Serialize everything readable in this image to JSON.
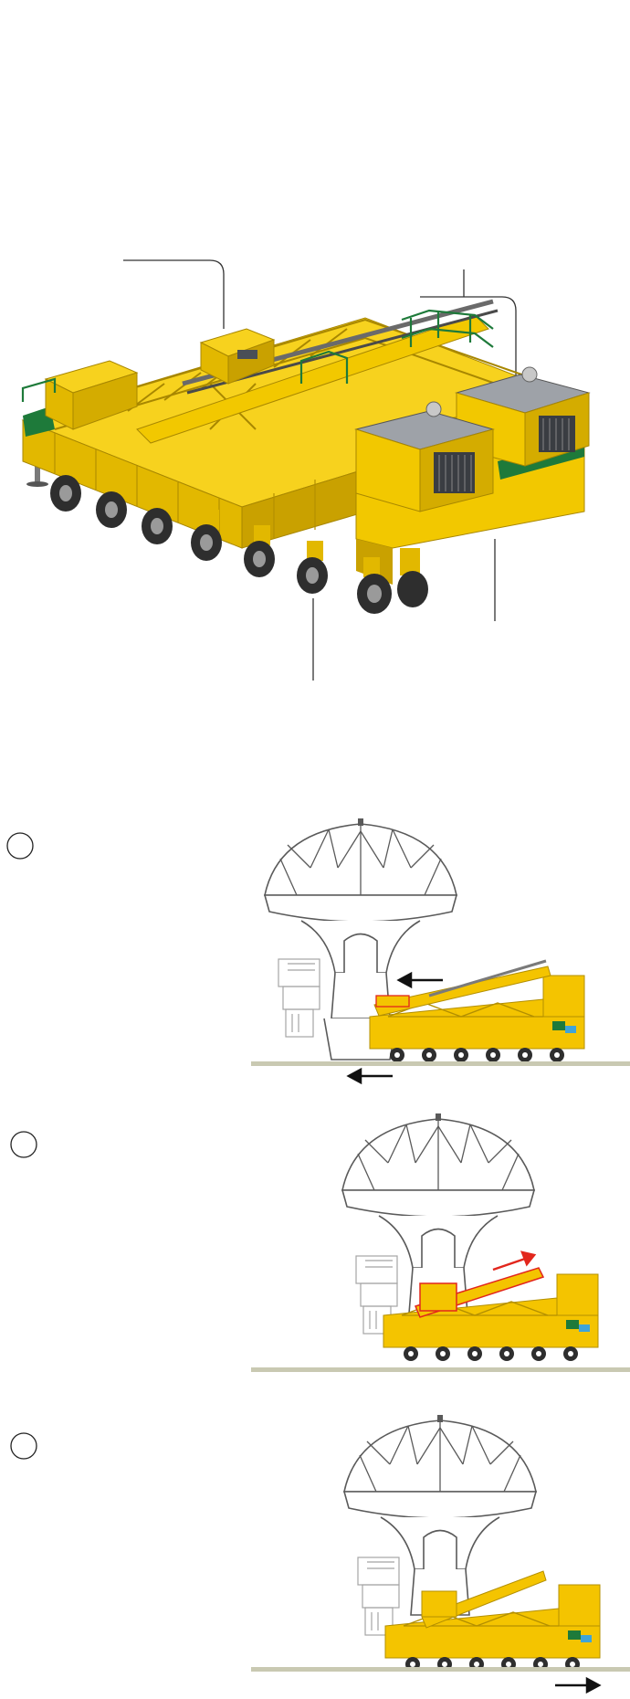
{
  "colors": {
    "vehicle_yellow": "#F4C400",
    "vehicle_dark": "#B89200",
    "vehicle_shadow": "#8C6E00",
    "rail_green": "#1E7A3A",
    "panel_grey": "#9EA2A8",
    "panel_dark": "#4A4F57",
    "tyre": "#2E2E2E",
    "ground": "#C9C9B2",
    "antenna_line": "#5A5A5A",
    "arrow_black": "#111111",
    "arrow_red": "#E2261C",
    "cradle_red": "#E2261C"
  },
  "figure": {
    "description_labels": []
  },
  "steps": [
    {
      "id": "step-1",
      "marker_label": "",
      "direction": "left"
    },
    {
      "id": "step-2",
      "marker_label": "",
      "direction": "lift"
    },
    {
      "id": "step-3",
      "marker_label": "",
      "direction": "right"
    }
  ]
}
